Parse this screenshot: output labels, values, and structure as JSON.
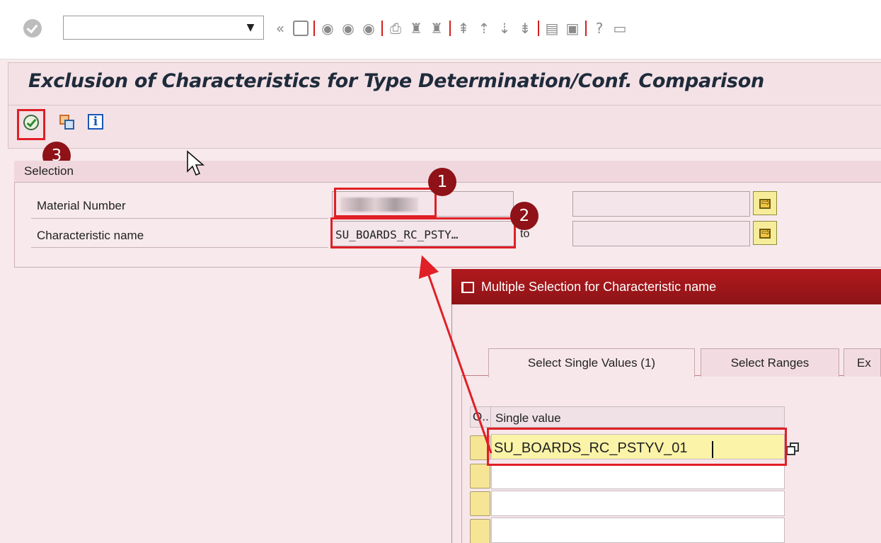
{
  "window": {
    "title": "Exclusion of Characteristics for Type Determination/Conf. Comparison"
  },
  "toolbar": {
    "command_value": "",
    "icons": [
      "ok-icon",
      "back-nav-icon",
      "save-icon",
      "back-icon",
      "exit-icon",
      "cancel-icon",
      "print-icon",
      "find-icon",
      "find-next-icon",
      "first-page-icon",
      "previous-page-icon",
      "next-page-icon",
      "last-page-icon",
      "new-session-icon",
      "shortcut-icon",
      "help-icon",
      "customize-layout-icon"
    ]
  },
  "app_toolbar": {
    "icons": [
      "execute-icon",
      "copy-icon",
      "info-icon"
    ]
  },
  "selection": {
    "title": "Selection",
    "fields": [
      {
        "label": "Material Number",
        "value": ""
      },
      {
        "label": "Characteristic name",
        "value": "SU_BOARDS_RC_PSTY…",
        "to_label": "to"
      }
    ]
  },
  "annotations": {
    "badges": [
      "1",
      "2",
      "3"
    ],
    "accent_color": "#e01f26",
    "badge_color": "#8e1218"
  },
  "popup": {
    "title": "Multiple Selection for Characteristic name",
    "tabs": [
      "Select Single Values (1)",
      "Select Ranges",
      "Ex"
    ],
    "grid": {
      "col_option": "O..",
      "col_value": "Single value",
      "rows": [
        "SU_BOARDS_RC_PSTYV_01",
        "",
        "",
        ""
      ]
    }
  },
  "colors": {
    "sap_title_bar": "#b0191d",
    "screen_background": "#f7e9ec",
    "selection_button": "#f7ec9a"
  }
}
